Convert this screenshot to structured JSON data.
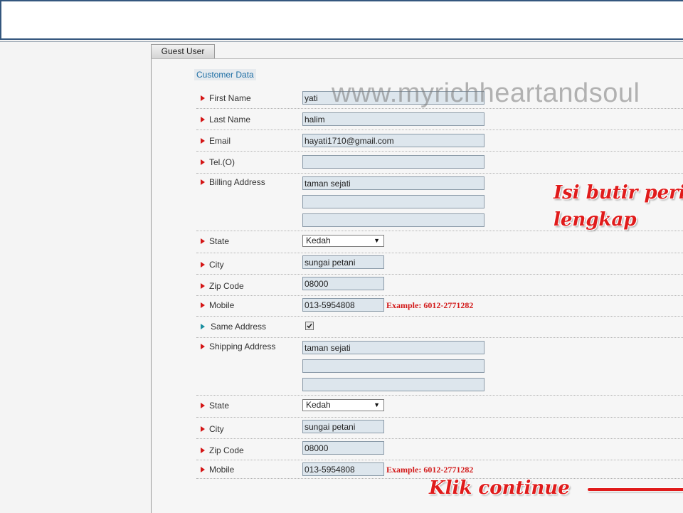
{
  "tab": {
    "label": "Guest User"
  },
  "section": {
    "title": "Customer Data"
  },
  "labels": {
    "first_name": "First Name",
    "last_name": "Last Name",
    "email": "Email",
    "tel": "Tel.(O)",
    "billing_address": "Billing Address",
    "state": "State",
    "city": "City",
    "zip": "Zip Code",
    "mobile": "Mobile",
    "same_address": "Same Address",
    "shipping_address": "Shipping Address"
  },
  "values": {
    "first_name": "yati",
    "last_name": "halim",
    "email": "hayati1710@gmail.com",
    "tel": "",
    "billing_address_1": "taman sejati",
    "billing_address_2": "",
    "billing_address_3": "",
    "billing_state": "Kedah",
    "billing_city": "sungai petani",
    "billing_zip": "08000",
    "billing_mobile": "013-5954808",
    "same_address_checked": true,
    "shipping_address_1": "taman sejati",
    "shipping_address_2": "",
    "shipping_address_3": "",
    "shipping_state": "Kedah",
    "shipping_city": "sungai petani",
    "shipping_zip": "08000",
    "shipping_mobile": "013-5954808"
  },
  "hints": {
    "mobile_example": "Example: 6012-2771282"
  },
  "overlay": {
    "watermark": "www.myrichheartandsoul",
    "annotation_line1": "Isi butir peri",
    "annotation_line2": "lengkap",
    "continue_note": "Klik continue"
  },
  "colors": {
    "accent_red": "#d41515",
    "section_blue": "#1f6fa5",
    "field_bg": "#dde6ed",
    "frame_blue": "#34577e"
  },
  "icons": {
    "bullet": "red-triangle-arrow",
    "same_address_bullet": "teal-triangle-arrow",
    "dropdown": "down-triangle",
    "checkbox": "checkmark"
  }
}
